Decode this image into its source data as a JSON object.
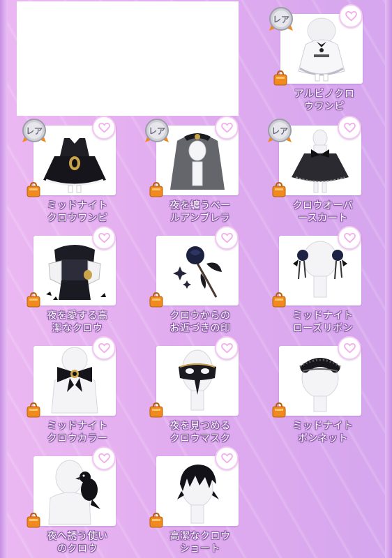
{
  "items": [
    {
      "id": "albino",
      "line1": "アルビノクロ",
      "line2": "ウワンピ",
      "rare": "レア",
      "art": "dress-white"
    },
    {
      "id": "midnight-dress",
      "line1": "ミッドナイト",
      "line2": "クロウワンピ",
      "rare": "レア",
      "art": "dress-black"
    },
    {
      "id": "veil",
      "line1": "夜を纏うベー",
      "line2": "ルアンブレラ",
      "rare": "レア",
      "art": "veil"
    },
    {
      "id": "skirt",
      "line1": "クロウオーバ",
      "line2": "ースカート",
      "rare": "レア",
      "art": "skirt"
    },
    {
      "id": "noble",
      "line1": "夜を愛する高",
      "line2": "潔なクロウ",
      "rare": "",
      "art": "outfit"
    },
    {
      "id": "seal",
      "line1": "クロウからの",
      "line2": "お近づきの印",
      "rare": "",
      "art": "rose"
    },
    {
      "id": "ribbon",
      "line1": "ミッドナイト",
      "line2": "ローズリボン",
      "rare": "",
      "art": "ribbons"
    },
    {
      "id": "collar",
      "line1": "ミッドナイト",
      "line2": "クロウカラー",
      "rare": "",
      "art": "collar"
    },
    {
      "id": "mask",
      "line1": "夜を見つめる",
      "line2": "クロウマスク",
      "rare": "",
      "art": "mask"
    },
    {
      "id": "bonnet",
      "line1": "ミッドナイト",
      "line2": "ボンネット",
      "rare": "",
      "art": "bonnet"
    },
    {
      "id": "crow",
      "line1": "夜へ誘う使い",
      "line2": "のクロウ",
      "rare": "",
      "art": "crow"
    },
    {
      "id": "hair",
      "line1": "高潔なクロウ",
      "line2": "ショート",
      "rare": "",
      "art": "hair"
    }
  ],
  "colors": {
    "accent": "#f2a9e8",
    "label_outline": "#8a5aa8",
    "bag": "#f08a1e"
  }
}
